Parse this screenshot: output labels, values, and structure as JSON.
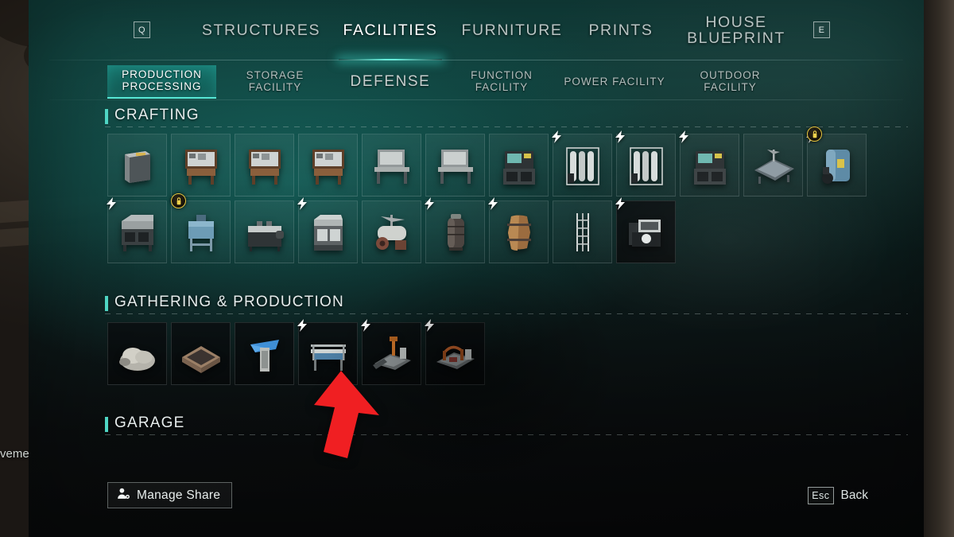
{
  "window": {
    "stray_world_text": "veme"
  },
  "topnav": {
    "left_key": "Q",
    "right_key": "E",
    "items": [
      {
        "label": "STRUCTURES",
        "active": false
      },
      {
        "label": "FACILITIES",
        "active": true
      },
      {
        "label": "FURNITURE",
        "active": false
      },
      {
        "label": "PRINTS",
        "active": false
      },
      {
        "label": "HOUSE\nBLUEPRINT",
        "active": false
      }
    ]
  },
  "subtabs": {
    "items": [
      {
        "label": "PRODUCTION\nPROCESSING",
        "active": true,
        "size": "small"
      },
      {
        "label": "STORAGE\nFACILITY",
        "active": false,
        "size": "small"
      },
      {
        "label": "DEFENSE",
        "active": false,
        "size": "big"
      },
      {
        "label": "FUNCTION\nFACILITY",
        "active": false,
        "size": "small"
      },
      {
        "label": "POWER FACILITY",
        "active": false,
        "size": "small"
      },
      {
        "label": "OUTDOOR\nFACILITY",
        "active": false,
        "size": "small"
      }
    ]
  },
  "sections": [
    {
      "title": "CRAFTING",
      "rows": [
        [
          {
            "name": "electric-smelter",
            "icon": "cabinet-unit",
            "powered": false,
            "locked": false,
            "dark": false
          },
          {
            "name": "workbench-a",
            "icon": "workbench",
            "powered": false,
            "locked": false,
            "dark": false
          },
          {
            "name": "workbench-b",
            "icon": "workbench",
            "powered": false,
            "locked": false,
            "dark": false
          },
          {
            "name": "workbench-c",
            "icon": "workbench",
            "powered": false,
            "locked": false,
            "dark": false
          },
          {
            "name": "work-table-a",
            "icon": "table-bench",
            "powered": false,
            "locked": false,
            "dark": false
          },
          {
            "name": "work-table-b",
            "icon": "table-bench",
            "powered": false,
            "locked": false,
            "dark": false
          },
          {
            "name": "machine-station",
            "icon": "machine-box",
            "powered": false,
            "locked": false,
            "dark": false
          },
          {
            "name": "gas-tank-rack",
            "icon": "tank-rack",
            "powered": true,
            "locked": false,
            "dark": false
          },
          {
            "name": "filtration-cabinet",
            "icon": "tank-rack",
            "powered": true,
            "locked": false,
            "dark": false
          },
          {
            "name": "fume-hood",
            "icon": "machine-box",
            "powered": true,
            "locked": false,
            "dark": false
          },
          {
            "name": "flat-press-table",
            "icon": "flat-plate",
            "powered": false,
            "locked": false,
            "dark": false
          },
          {
            "name": "chemical-vat",
            "icon": "barrel-blue",
            "powered": true,
            "locked": true,
            "dark": false
          }
        ],
        [
          {
            "name": "grill-station",
            "icon": "grill",
            "powered": true,
            "locked": false,
            "dark": false
          },
          {
            "name": "blue-mixer",
            "icon": "mixer-blue",
            "powered": false,
            "locked": true,
            "dark": false
          },
          {
            "name": "stove-unit",
            "icon": "stove",
            "powered": false,
            "locked": false,
            "dark": false
          },
          {
            "name": "oven-unit",
            "icon": "oven",
            "powered": true,
            "locked": false,
            "dark": false
          },
          {
            "name": "roller-machine",
            "icon": "roller",
            "powered": false,
            "locked": false,
            "dark": false
          },
          {
            "name": "pressure-tank",
            "icon": "tank-tall",
            "powered": true,
            "locked": false,
            "dark": false
          },
          {
            "name": "wooden-barrel",
            "icon": "barrel-wood",
            "powered": true,
            "locked": false,
            "dark": false
          },
          {
            "name": "scaffold-tower",
            "icon": "scaffold",
            "powered": false,
            "locked": false,
            "dark": false
          },
          {
            "name": "printer-rig",
            "icon": "printer",
            "powered": true,
            "locked": false,
            "dark": true
          }
        ]
      ]
    },
    {
      "title": "GATHERING & PRODUCTION",
      "rows": [
        [
          {
            "name": "ore-pile",
            "icon": "rock-pile",
            "powered": false,
            "locked": false,
            "dark": true
          },
          {
            "name": "planter-box",
            "icon": "planter",
            "powered": false,
            "locked": false,
            "dark": true
          },
          {
            "name": "water-well",
            "icon": "well-blue",
            "powered": false,
            "locked": false,
            "dark": true
          },
          {
            "name": "conveyor-bench",
            "icon": "conveyor",
            "powered": true,
            "locked": false,
            "dark": true
          },
          {
            "name": "drill-platform",
            "icon": "drill-rig",
            "powered": true,
            "locked": false,
            "dark": true
          },
          {
            "name": "pump-platform",
            "icon": "pump-rig",
            "powered": true,
            "locked": false,
            "dark": true
          }
        ]
      ]
    },
    {
      "title": "GARAGE",
      "rows": []
    }
  ],
  "footer": {
    "manage_share_label": "Manage Share",
    "back_key": "Esc",
    "back_label": "Back"
  },
  "colors": {
    "accent_teal": "#4fd6c4",
    "panel_teal": "#12463f",
    "lock_gold": "#e7c73f",
    "arrow_red": "#f01f22",
    "text_primary": "#ffffff",
    "text_muted": "#b9c4c3"
  }
}
